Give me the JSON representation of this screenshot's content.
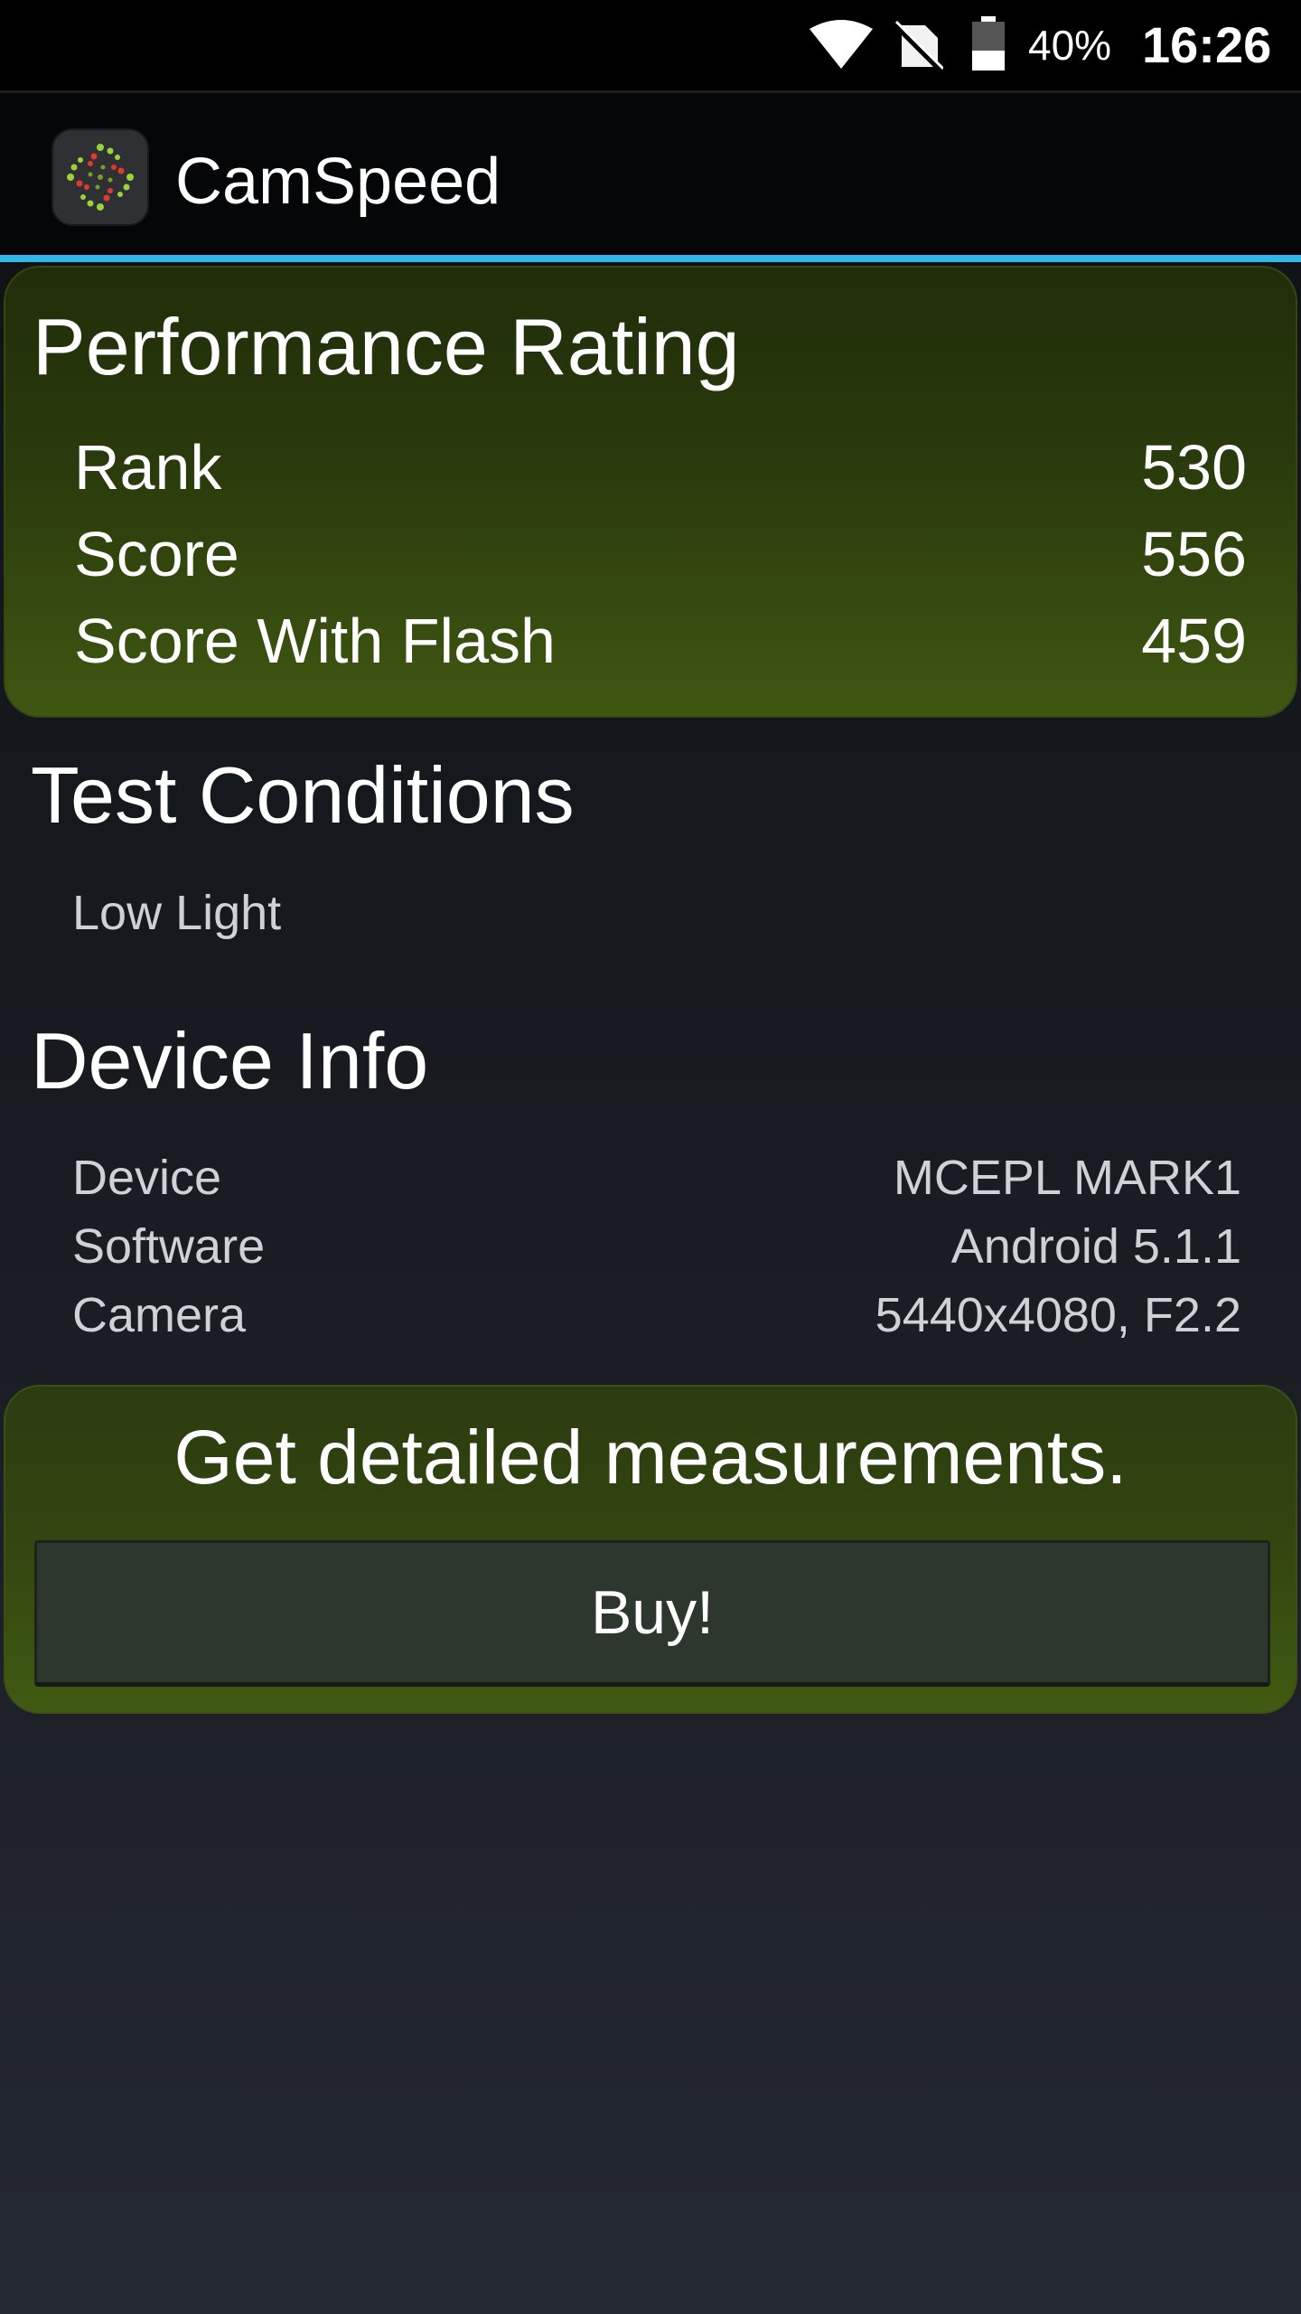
{
  "status_bar": {
    "battery_percent": "40%",
    "time": "16:26",
    "icons": [
      "wifi-icon",
      "no-sim-icon",
      "battery-icon"
    ]
  },
  "app_bar": {
    "title": "CamSpeed",
    "icon": "camspeed-app-icon"
  },
  "performance": {
    "title": "Performance Rating",
    "rows": [
      {
        "label": "Rank",
        "value": "530"
      },
      {
        "label": "Score",
        "value": "556"
      },
      {
        "label": "Score With Flash",
        "value": "459"
      }
    ]
  },
  "test_conditions": {
    "title": "Test Conditions",
    "value": "Low Light"
  },
  "device_info": {
    "title": "Device Info",
    "rows": [
      {
        "label": "Device",
        "value": "MCEPL MARK1"
      },
      {
        "label": "Software",
        "value": "Android 5.1.1"
      },
      {
        "label": "Camera",
        "value": "5440x4080, F2.2"
      }
    ]
  },
  "promo": {
    "text": "Get detailed measurements.",
    "buy_label": "Buy!"
  },
  "colors": {
    "accent": "#33b5e5",
    "panel_green": "#3f5712",
    "background": "#15181d"
  }
}
